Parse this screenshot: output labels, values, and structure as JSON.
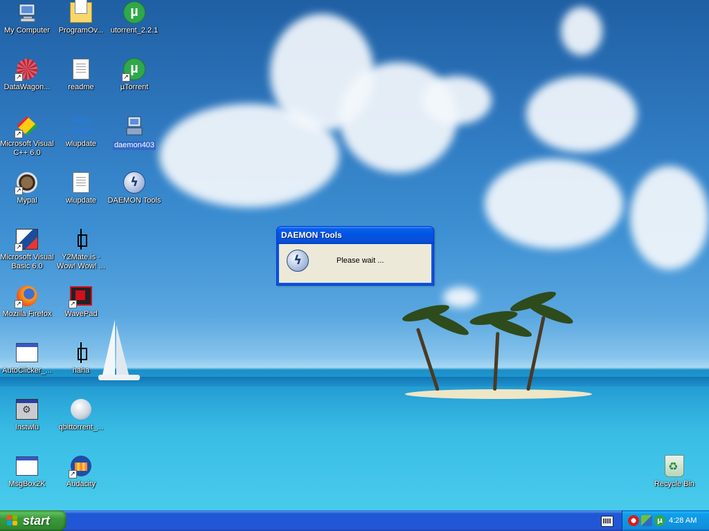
{
  "desktop": {
    "icons": [
      {
        "label": "My Computer"
      },
      {
        "label": "ProgramOv..."
      },
      {
        "label": "utorrent_2.2.1"
      },
      {
        "label": "DataWagon..."
      },
      {
        "label": "readme"
      },
      {
        "label": "µTorrent"
      },
      {
        "label": "Microsoft Visual C++ 6.0"
      },
      {
        "label": "wlupdate"
      },
      {
        "label": "daemon403"
      },
      {
        "label": "Mypal"
      },
      {
        "label": "wlupdate"
      },
      {
        "label": "DAEMON Tools"
      },
      {
        "label": "Microsoft Visual Basic 6.0"
      },
      {
        "label": "Y2Mate.is - Wow! Wow! ..."
      },
      {
        "label": "Mozilla Firefox"
      },
      {
        "label": "WavePad"
      },
      {
        "label": "AutoClicker_..."
      },
      {
        "label": "haha"
      },
      {
        "label": "Instwlu"
      },
      {
        "label": "qbittorrent_..."
      },
      {
        "label": "MsgBox2K"
      },
      {
        "label": "Audacity"
      },
      {
        "label": "Recycle Bin"
      }
    ],
    "win2000_glyph": "Win 2000"
  },
  "dialog": {
    "title": "DAEMON Tools",
    "message": "Please wait ...",
    "icon": "daemon-tools-icon"
  },
  "taskbar": {
    "start_label": "start",
    "clock": "4:28 AM",
    "tray_icons": [
      "daemon-tools-tray-icon",
      "network-tray-icon",
      "utorrent-tray-icon"
    ]
  },
  "colors": {
    "taskbar_blue": "#2157d7",
    "start_green": "#3c9a3c",
    "dialog_title_blue": "#0054e3",
    "dialog_body": "#ece9d8",
    "selection_blue": "#316ac5"
  }
}
